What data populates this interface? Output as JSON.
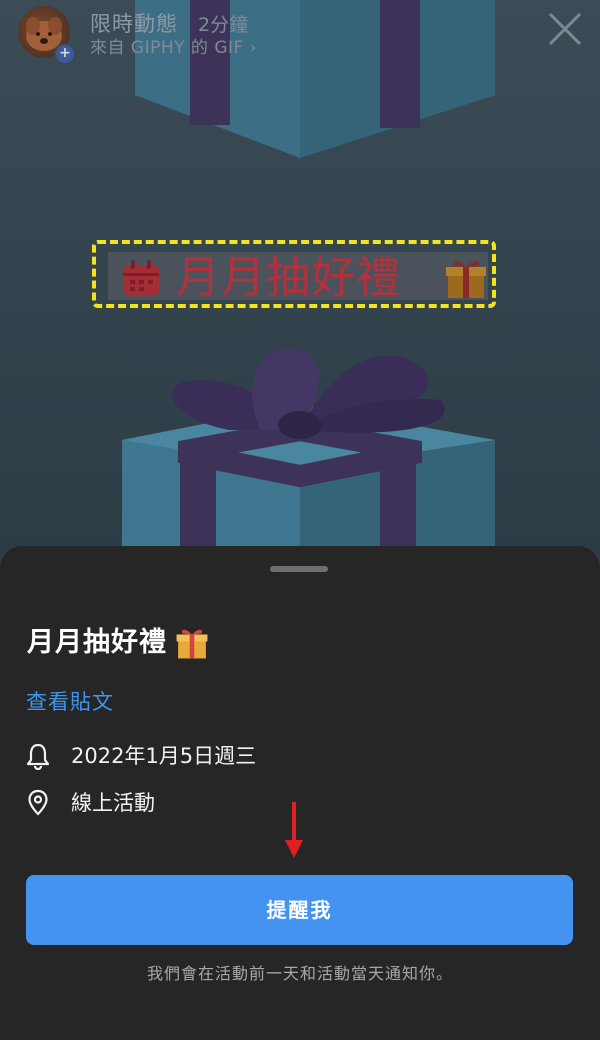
{
  "story": {
    "title": "限時動態",
    "time": "2分鐘",
    "source": "來自 GIPHY 的 GIF",
    "source_chevron": "›",
    "avatar_add": "+",
    "banner_text": "月月抽好禮"
  },
  "sheet": {
    "title": "月月抽好禮",
    "view_post": "查看貼文",
    "date": "2022年1月5日週三",
    "location": "線上活動",
    "remind_button": "提醒我",
    "note": "我們會在活動前一天和活動當天通知你。"
  },
  "colors": {
    "accent": "#4593f0",
    "link": "#3e96f0",
    "banner_text": "#b0323c",
    "banner_border": "#f5e31c",
    "sheet_bg": "#262626"
  },
  "icons": {
    "avatar": "brown-dog-avatar",
    "close": "close-icon",
    "calendar": "calendar-icon",
    "gift": "gift-icon",
    "bell": "bell-icon",
    "location": "location-pin-icon",
    "annotation": "red-arrow-down-icon"
  }
}
